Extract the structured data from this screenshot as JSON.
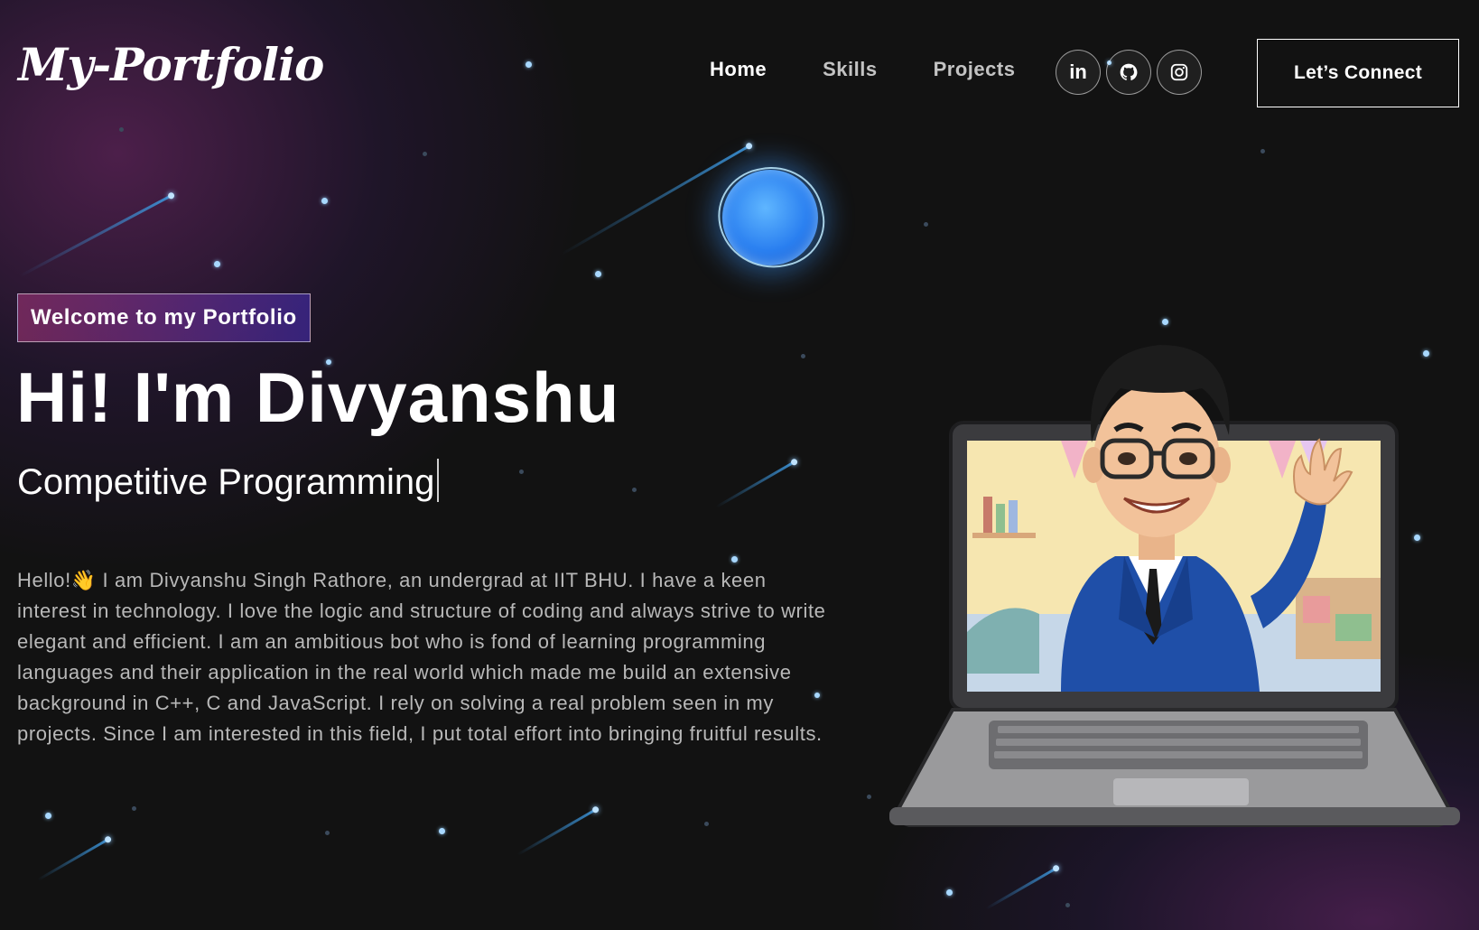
{
  "nav": {
    "logo": "My-Portfolio",
    "links": [
      {
        "label": "Home",
        "active": true
      },
      {
        "label": "Skills",
        "active": false
      },
      {
        "label": "Projects",
        "active": false
      }
    ],
    "socials": [
      {
        "icon": "linkedin-icon",
        "label": "in"
      },
      {
        "icon": "github-icon"
      },
      {
        "icon": "instagram-icon"
      }
    ],
    "connect_label": "Let’s Connect"
  },
  "hero": {
    "tagline": "Welcome to my Portfolio",
    "title": "Hi! I'm Divyanshu",
    "rotating_text": "Competitive Programming",
    "bio": "Hello!👋 I am Divyanshu Singh Rathore, an undergrad at IIT BHU. I have a keen interest in technology. I love the logic and structure of coding and always strive to write elegant and efficient. I am an ambitious bot who is fond of learning programming languages and their application in the real world which made me build an extensive background in C++, C and JavaScript. I rely on solving a real problem seen in my projects. Since I am interested in this field, I put total effort into bringing fruitful results."
  },
  "illustration": {
    "icon": "avatar-laptop-illustration"
  },
  "colors": {
    "background": "#121212",
    "accent_pink": "#aa367c",
    "accent_purple": "#4a2fbd",
    "star_blue": "#a8d8ff"
  }
}
